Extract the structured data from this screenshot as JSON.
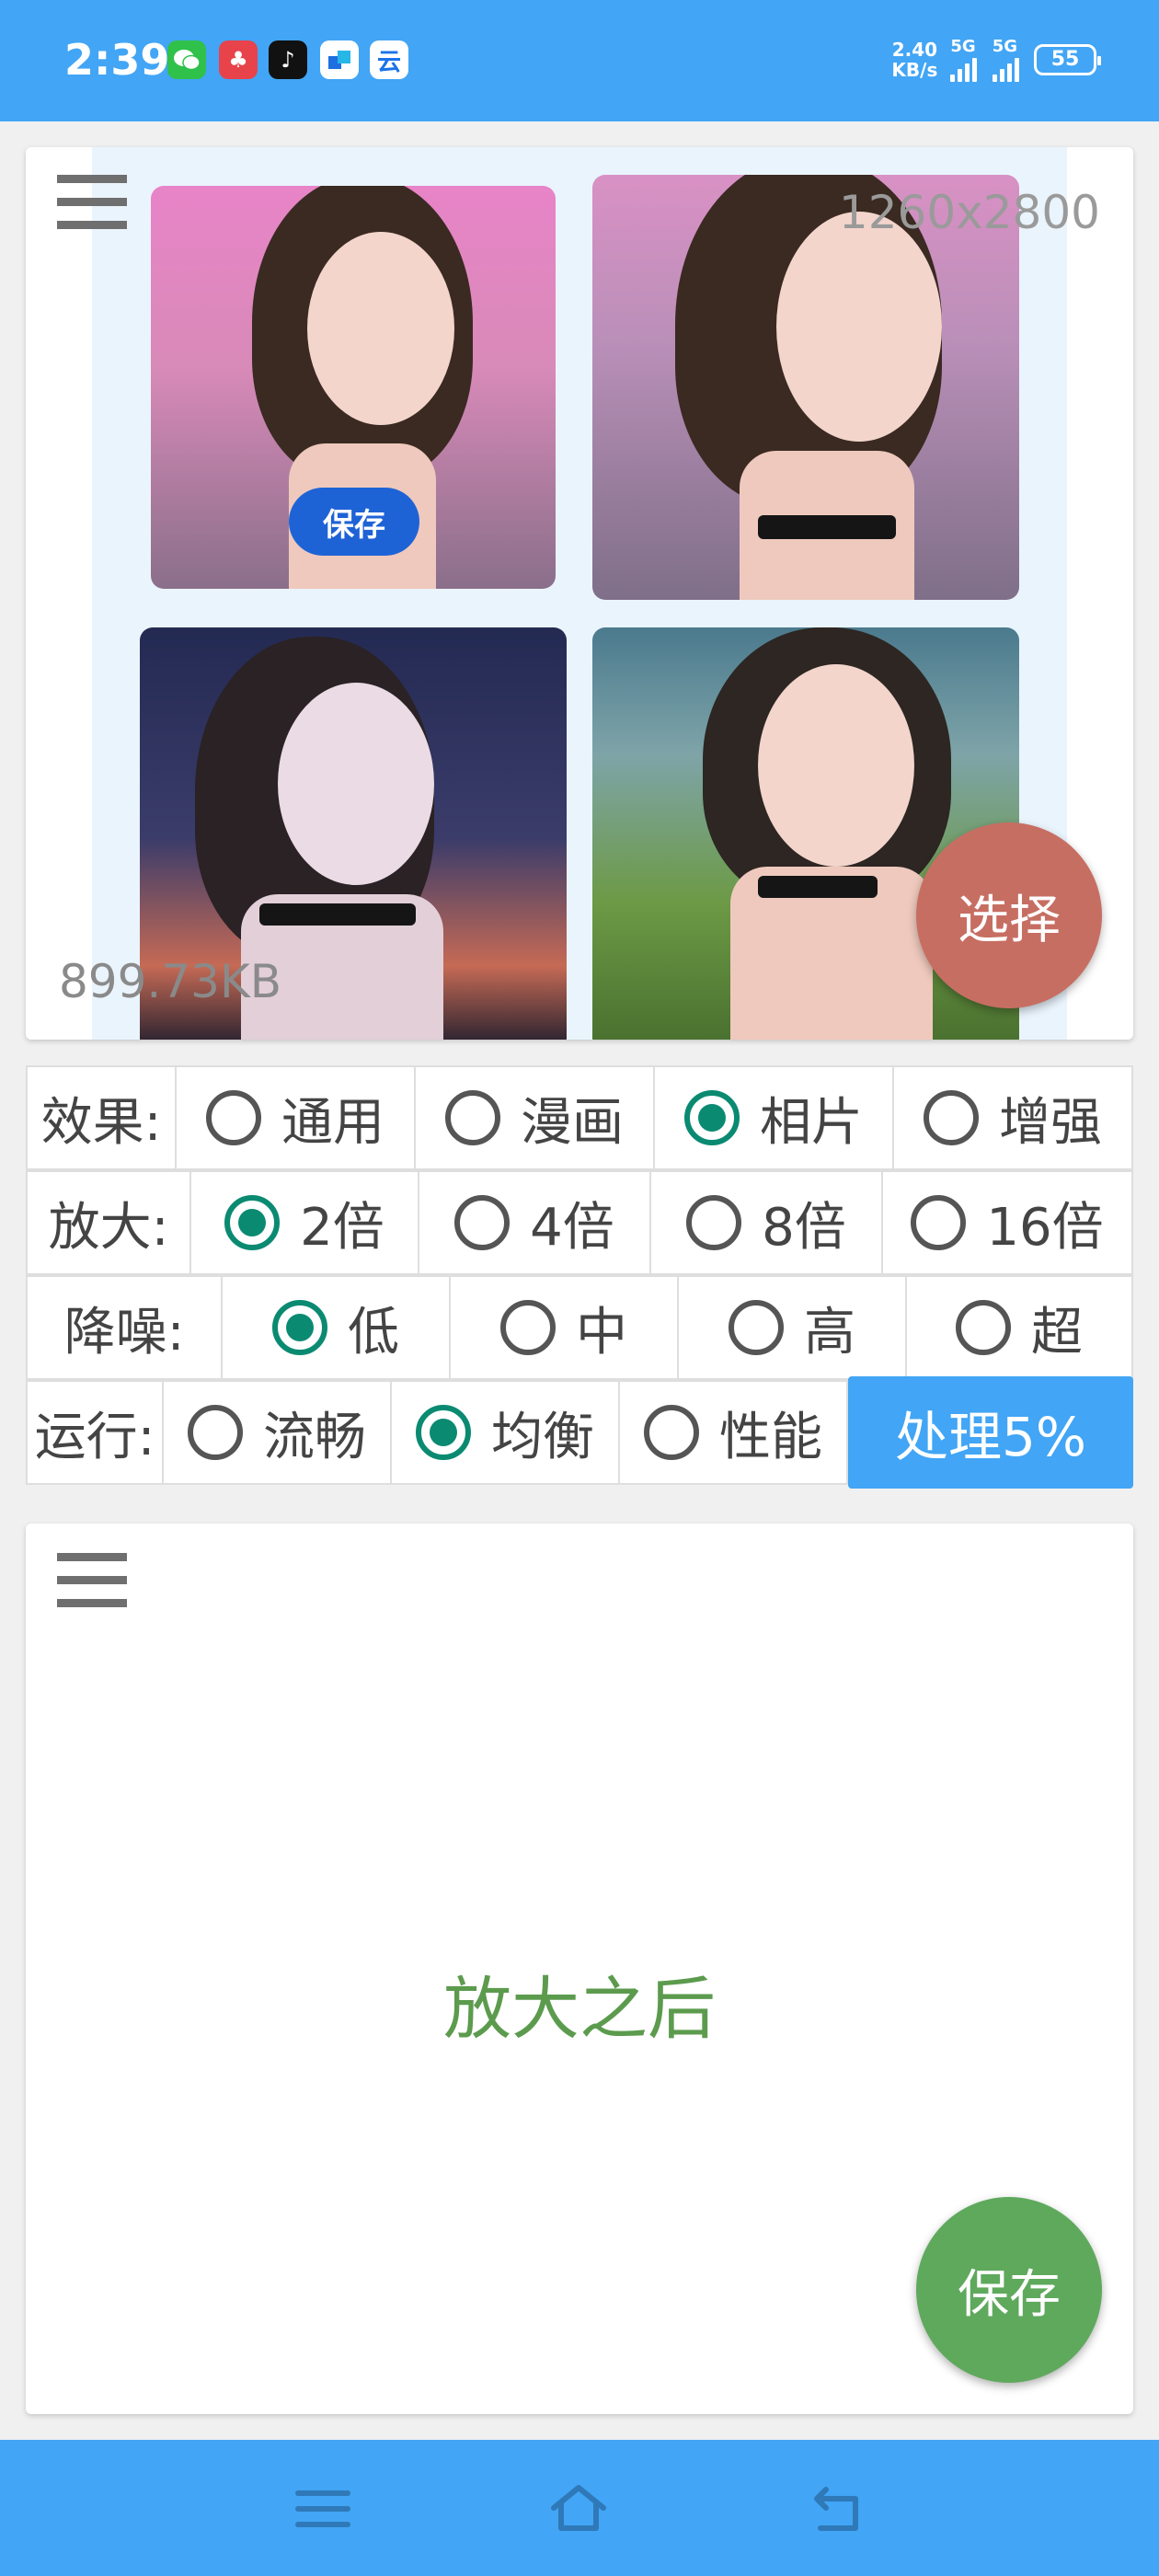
{
  "status_bar": {
    "time": "2:39",
    "net_speed_value": "2.40",
    "net_speed_unit": "KB/s",
    "sim1": "5G",
    "sim2": "5G",
    "battery": "55",
    "app_icons": [
      "wechat-icon",
      "game-app-icon",
      "tiktok-icon",
      "tasks-app-icon",
      "cloud-app-icon"
    ]
  },
  "input_card": {
    "resolution": "1260x2800",
    "file_size": "899.73KB",
    "save_chip_label": "保存",
    "select_button_label": "选择"
  },
  "options": {
    "effect": {
      "label": "效果:",
      "choices": [
        "通用",
        "漫画",
        "相片",
        "增强"
      ],
      "selected": "相片"
    },
    "scale": {
      "label": "放大:",
      "choices": [
        "2倍",
        "4倍",
        "8倍",
        "16倍"
      ],
      "selected": "2倍"
    },
    "denoise": {
      "label": "降噪:",
      "choices": [
        "低",
        "中",
        "高",
        "超"
      ],
      "selected": "低"
    },
    "run_mode": {
      "label": "运行:",
      "choices": [
        "流畅",
        "均衡",
        "性能"
      ],
      "selected": "均衡"
    },
    "process_button_label": "处理5%"
  },
  "output_card": {
    "placeholder": "放大之后",
    "save_button_label": "保存"
  },
  "colors": {
    "accent_blue": "#42a5f5",
    "radio_checked": "#0b8a72",
    "select_fab": "#c76e63",
    "save_fab": "#5fa95d",
    "placeholder_text": "#5c9b4e"
  },
  "navigation": {
    "buttons": [
      "menu-icon",
      "home-icon",
      "back-icon"
    ]
  }
}
